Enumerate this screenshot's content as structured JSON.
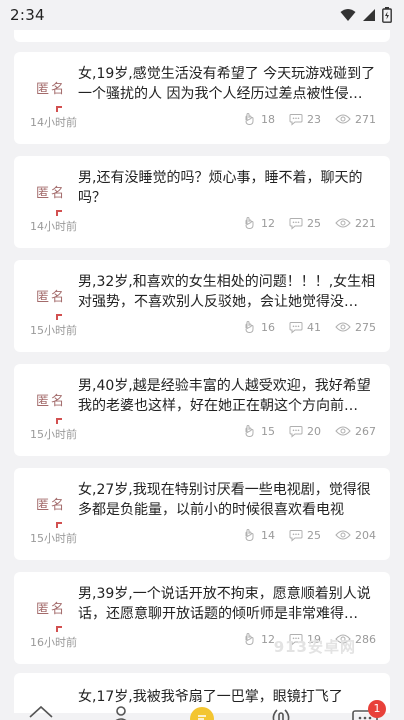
{
  "status": {
    "time": "2:34"
  },
  "badge_label": "匿名",
  "posts": [
    {
      "title": "女,19岁,感觉生活没有希望了 今天玩游戏碰到了一个骚扰的人 因为我个人经历过差点被性侵害的…",
      "time": "14小时前",
      "likes": "18",
      "comments": "23",
      "views": "271"
    },
    {
      "title": "男,还有没睡觉的吗？烦心事，睡不着，聊天的吗？",
      "time": "14小时前",
      "likes": "12",
      "comments": "25",
      "views": "221"
    },
    {
      "title": "男,32岁,和喜欢的女生相处的问题！！！,女生相对强势，不喜欢别人反驳她，会让她觉得没…",
      "time": "15小时前",
      "likes": "16",
      "comments": "41",
      "views": "275"
    },
    {
      "title": "男,40岁,越是经验丰富的人越受欢迎，我好希望我的老婆也这样，好在她正在朝这个方向前…",
      "time": "15小时前",
      "likes": "15",
      "comments": "20",
      "views": "267"
    },
    {
      "title": "女,27岁,我现在特别讨厌看一些电视剧，觉得很多都是负能量，以前小的时候很喜欢看电视",
      "time": "15小时前",
      "likes": "14",
      "comments": "25",
      "views": "204"
    },
    {
      "title": "男,39岁,一个说话开放不拘束，愿意顺着别人说话，还愿意聊开放话题的倾听师是非常难得…",
      "time": "16小时前",
      "likes": "12",
      "comments": "19",
      "views": "286"
    }
  ],
  "partial_post": {
    "title": "女,17岁,我被我爷扇了一巴掌，眼镜打飞了"
  },
  "tabbar": {
    "messages_badge": "1"
  },
  "watermark": "913安卓网",
  "colors": {
    "accent_yellow": "#f3c531",
    "badge_red": "#e8413a"
  }
}
